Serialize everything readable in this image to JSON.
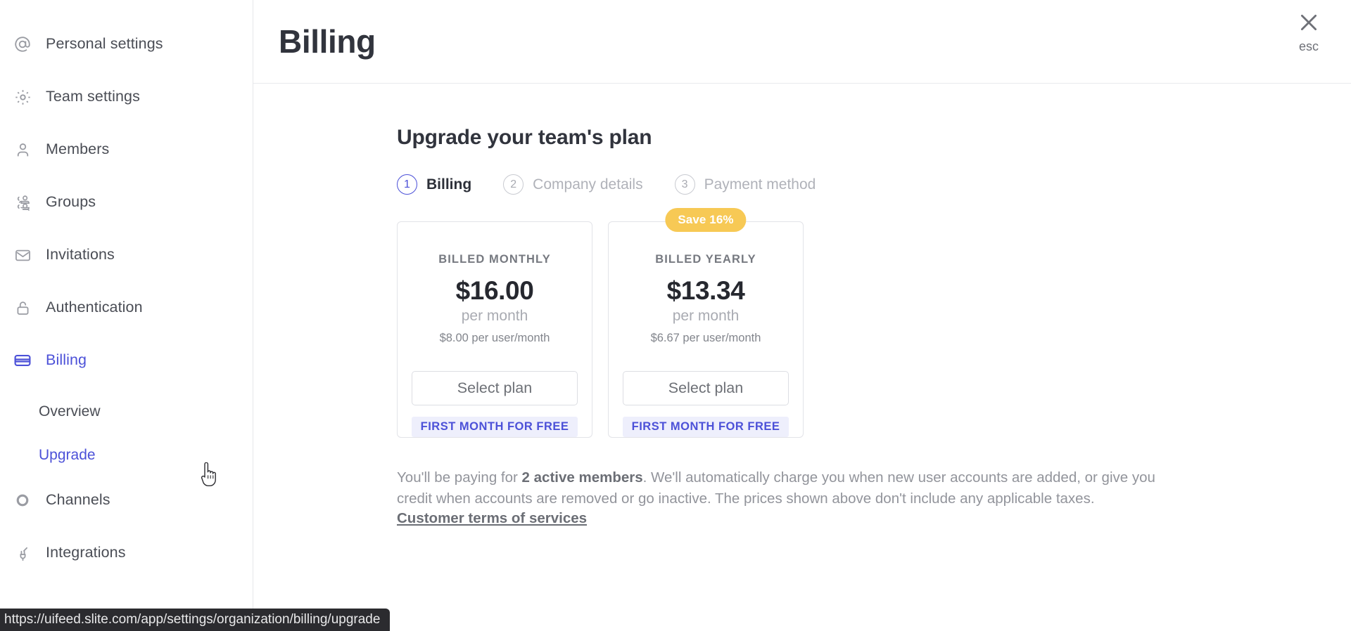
{
  "sidebar": {
    "items": [
      {
        "label": "Personal settings",
        "icon": "at-sign-icon",
        "active": false
      },
      {
        "label": "Team settings",
        "icon": "gear-icon",
        "active": false
      },
      {
        "label": "Members",
        "icon": "user-icon",
        "active": false
      },
      {
        "label": "Groups",
        "icon": "users-group-icon",
        "active": false
      },
      {
        "label": "Invitations",
        "icon": "envelope-icon",
        "active": false
      },
      {
        "label": "Authentication",
        "icon": "lock-icon",
        "active": false
      },
      {
        "label": "Billing",
        "icon": "credit-card-icon",
        "active": true
      }
    ],
    "sub_items": [
      {
        "label": "Overview",
        "active": false
      },
      {
        "label": "Upgrade",
        "active": true
      }
    ],
    "items_after": [
      {
        "label": "Channels",
        "icon": "circle-icon",
        "active": false
      },
      {
        "label": "Integrations",
        "icon": "plug-icon",
        "active": false
      }
    ]
  },
  "header": {
    "title": "Billing",
    "close_icon": "close-icon",
    "esc_label": "esc"
  },
  "main": {
    "section_title": "Upgrade your team's plan",
    "steps": [
      {
        "number": "1",
        "label": "Billing",
        "active": true
      },
      {
        "number": "2",
        "label": "Company details",
        "active": false
      },
      {
        "number": "3",
        "label": "Payment method",
        "active": false
      }
    ],
    "plans": [
      {
        "kicker": "BILLED MONTHLY",
        "price": "$16.00",
        "period": "per month",
        "unit": "$8.00 per user/month",
        "select_label": "Select plan",
        "free_label": "FIRST MONTH FOR FREE",
        "badge": ""
      },
      {
        "kicker": "BILLED YEARLY",
        "price": "$13.34",
        "period": "per month",
        "unit": "$6.67 per user/month",
        "select_label": "Select plan",
        "free_label": "FIRST MONTH FOR FREE",
        "badge": "Save 16%"
      }
    ],
    "note_part1": "You'll be paying for ",
    "note_bold": "2 active members",
    "note_part2": ". We'll automatically charge you when new user accounts are added, or give you credit when accounts are removed or go inactive. The prices shown above don't include any applicable taxes.",
    "terms_link": "Customer terms of services"
  },
  "status_bar": {
    "url": "https://uifeed.slite.com/app/settings/organization/billing/upgrade"
  },
  "colors": {
    "accent": "#4c51d8",
    "badge": "#f7c955",
    "text_dark": "#31343d",
    "text_muted": "#92949b"
  }
}
